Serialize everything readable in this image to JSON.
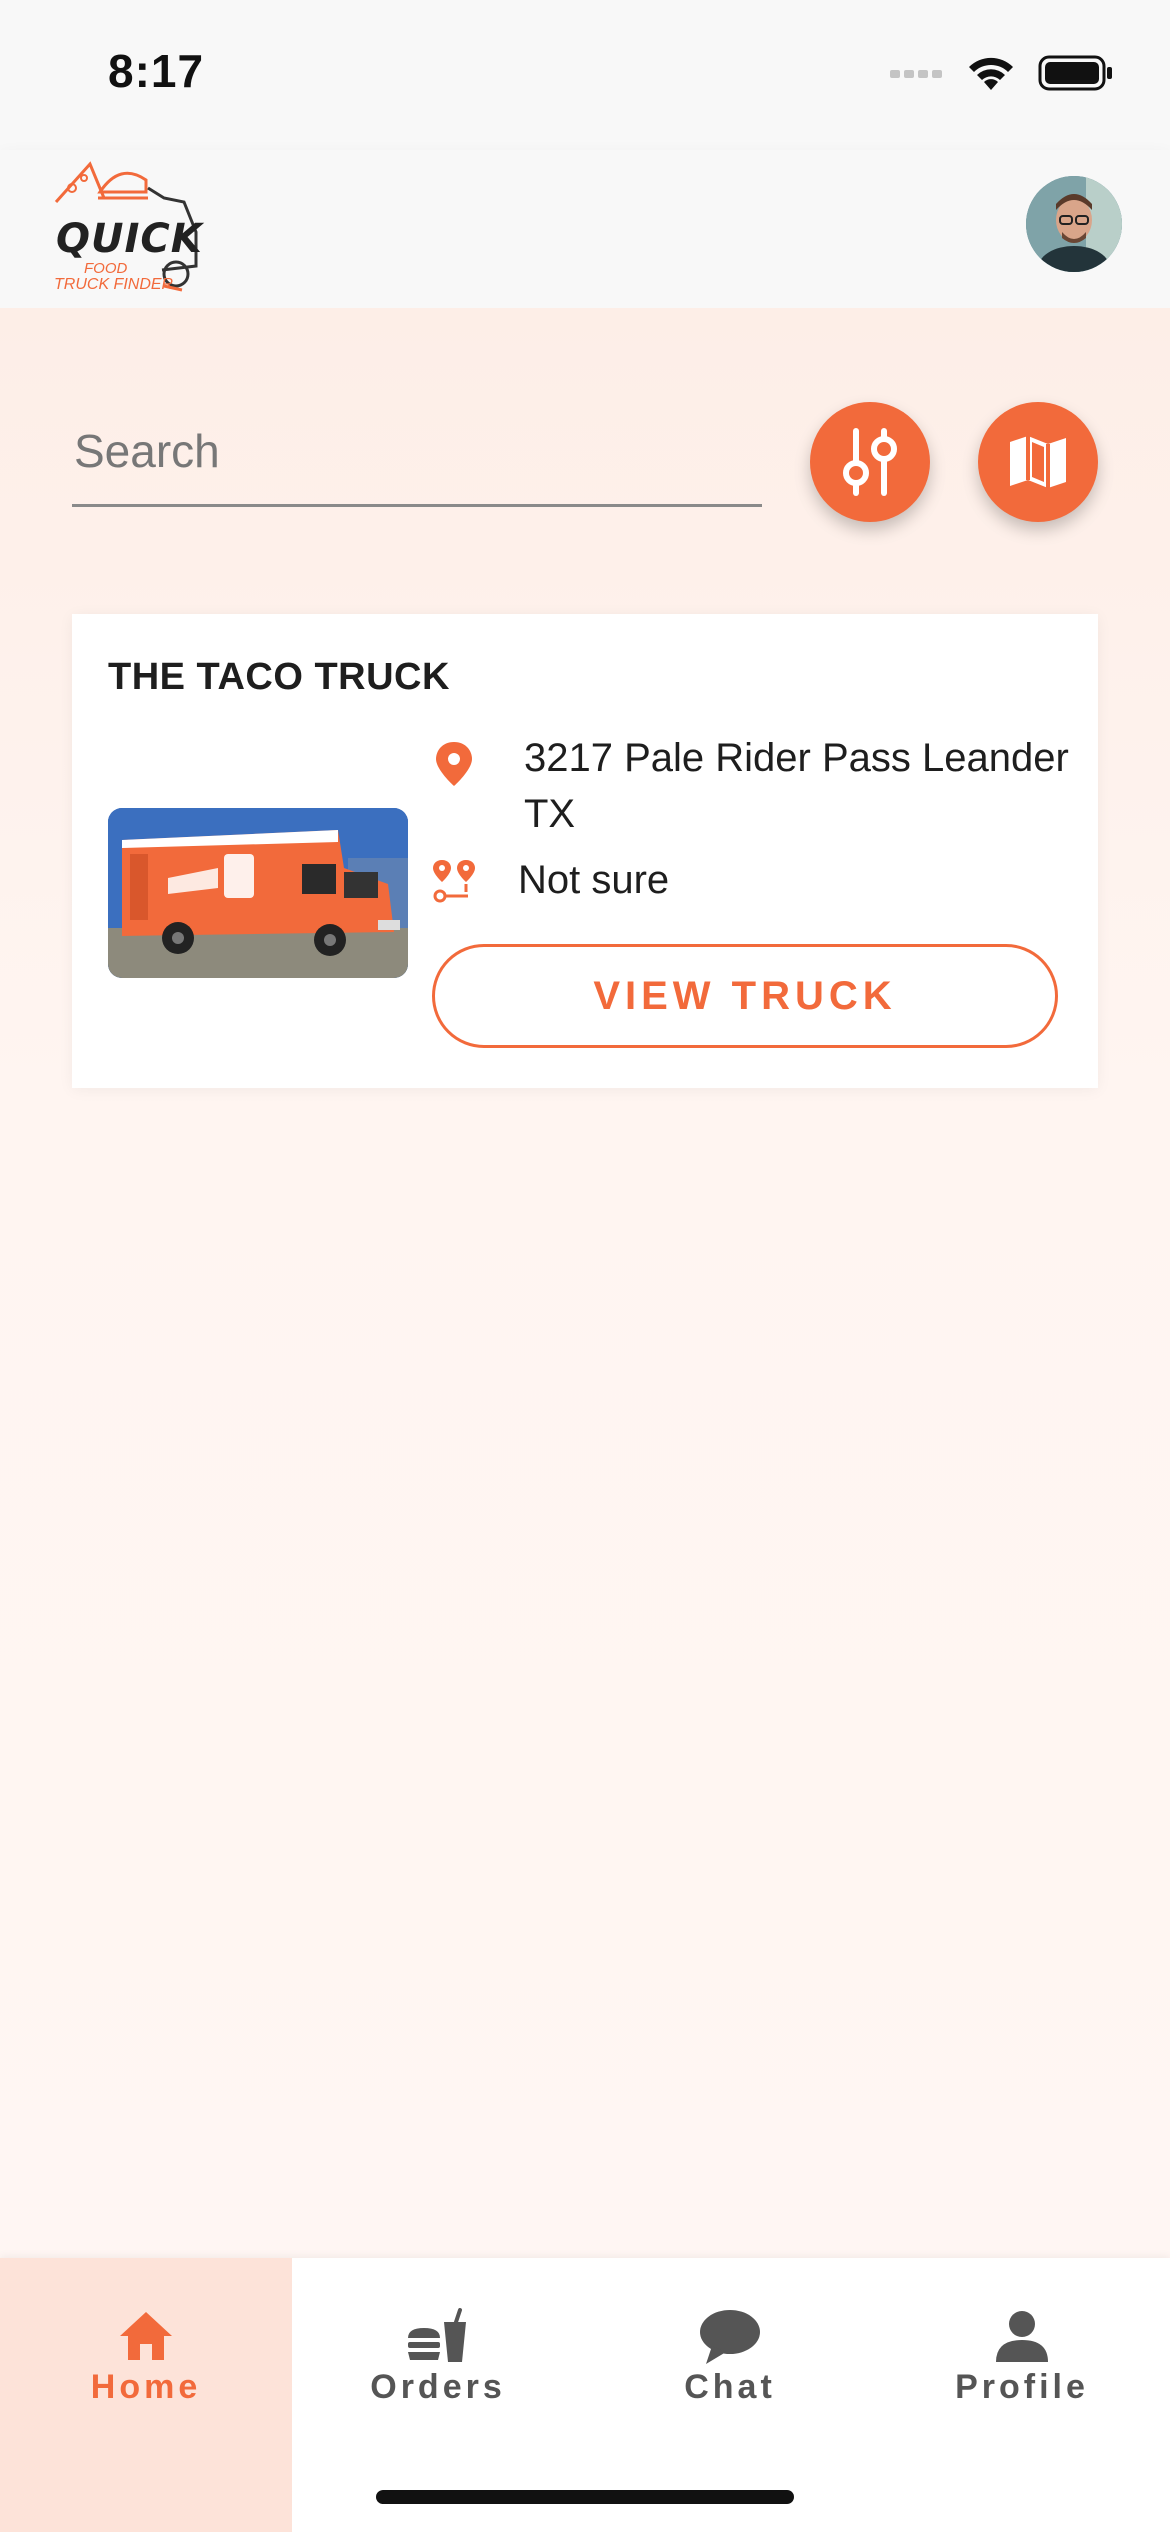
{
  "status_bar": {
    "time": "8:17"
  },
  "header": {
    "logo": {
      "brand": "QUICK",
      "line2": "FOOD",
      "line3": "TRUCK FINDER"
    }
  },
  "search": {
    "placeholder": "Search"
  },
  "colors": {
    "accent": "#f26a3b",
    "background": "#fff7f3",
    "nav_active_bg": "#fde3d9"
  },
  "truck_card": {
    "name": "THE TACO TRUCK",
    "address": "3217 Pale Rider Pass Leander TX",
    "distance": "Not sure",
    "view_button": "VIEW TRUCK"
  },
  "bottom_nav": {
    "items": [
      {
        "label": "Home",
        "icon": "home-icon",
        "active": true
      },
      {
        "label": "Orders",
        "icon": "orders-icon",
        "active": false
      },
      {
        "label": "Chat",
        "icon": "chat-icon",
        "active": false
      },
      {
        "label": "Profile",
        "icon": "profile-icon",
        "active": false
      }
    ]
  }
}
